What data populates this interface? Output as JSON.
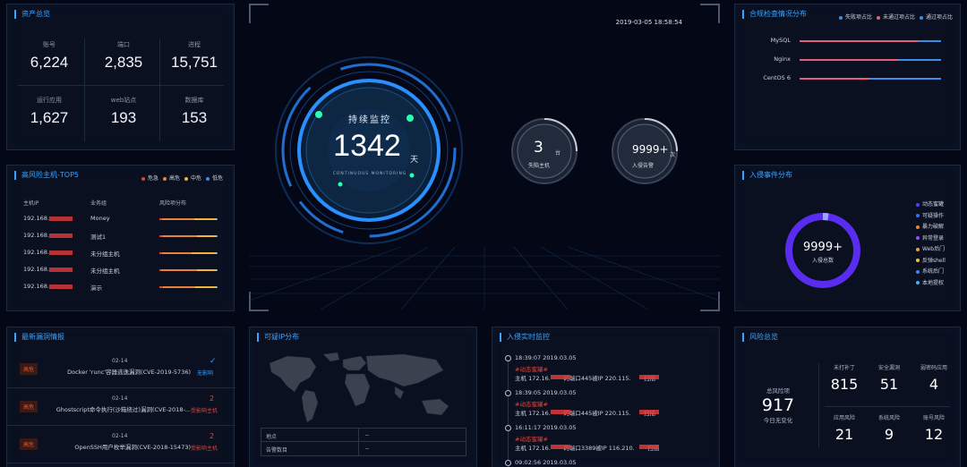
{
  "assets": {
    "title": "资产总览",
    "cells": [
      {
        "label": "账号",
        "value": "6,224"
      },
      {
        "label": "端口",
        "value": "2,835"
      },
      {
        "label": "进程",
        "value": "15,751"
      },
      {
        "label": "运行应用",
        "value": "1,627"
      },
      {
        "label": "web站点",
        "value": "193"
      },
      {
        "label": "数据库",
        "value": "153"
      }
    ]
  },
  "risk_hosts": {
    "title": "高风险主机-TOP5",
    "legend": [
      {
        "label": "危急",
        "color": "#e0453a"
      },
      {
        "label": "高危",
        "color": "#e8823a"
      },
      {
        "label": "中危",
        "color": "#f0b43a"
      },
      {
        "label": "低危",
        "color": "#3a8ee8"
      }
    ],
    "headers": {
      "ip": "主机IP",
      "group": "业务组",
      "dist": "风险项分布"
    },
    "rows": [
      {
        "ip": "192.168.",
        "group": "Money",
        "dist": [
          0.05,
          0.55,
          0.38,
          0.02
        ]
      },
      {
        "ip": "192.168.",
        "group": "测试1",
        "dist": [
          0.04,
          0.6,
          0.34,
          0.02
        ]
      },
      {
        "ip": "192.168.",
        "group": "未分组主机",
        "dist": [
          0.05,
          0.5,
          0.43,
          0.02
        ]
      },
      {
        "ip": "192.168.",
        "group": "未分组主机",
        "dist": [
          0.03,
          0.62,
          0.33,
          0.02
        ]
      },
      {
        "ip": "192.168.",
        "group": "演示",
        "dist": [
          0.06,
          0.56,
          0.36,
          0.02
        ]
      }
    ]
  },
  "center": {
    "datetime": "2019-03-05 18:58:54",
    "monitor_label": "持续监控",
    "days": "1342",
    "days_unit": "天",
    "monitor_sub": "CONTINUOUS MONITORING",
    "hosts_value": "3",
    "hosts_unit": "台",
    "hosts_label": "失陷主机",
    "alerts_value": "9999+",
    "alerts_unit": "次",
    "alerts_label": "入侵告警"
  },
  "compliance": {
    "title": "合规检查情况分布",
    "legend": [
      {
        "label": "失败项占比",
        "color": "#3a8ee8"
      },
      {
        "label": "未通过项占比",
        "color": "#e0607a"
      },
      {
        "label": "通过项占比",
        "color": "#3a8ee8"
      }
    ],
    "rows": [
      {
        "name": "MySQL",
        "fail": 0.84,
        "pass": 0.16
      },
      {
        "name": "Nginx",
        "fail": 0.7,
        "pass": 0.3
      },
      {
        "name": "CentOS 6",
        "fail": 0.5,
        "pass": 0.5
      }
    ]
  },
  "intrusion": {
    "title": "入侵事件分布",
    "total": "9999+",
    "total_label": "入侵总数",
    "legend": [
      {
        "label": "动态蜜罐",
        "color": "#5a3aff"
      },
      {
        "label": "可疑操作",
        "color": "#3a6cff"
      },
      {
        "label": "暴力破解",
        "color": "#e8823a"
      },
      {
        "label": "异常登录",
        "color": "#9a4aff"
      },
      {
        "label": "Web后门",
        "color": "#e8a23a"
      },
      {
        "label": "反弹shell",
        "color": "#f0c43a"
      },
      {
        "label": "系统后门",
        "color": "#3a8ee8"
      },
      {
        "label": "本地提权",
        "color": "#3ab0ff"
      }
    ]
  },
  "vulns": {
    "title": "最新漏洞情报",
    "items": [
      {
        "level": "高危",
        "date": "02-14",
        "name": "Docker 'runc'容器逃逸漏洞(CVE-2019-5736)",
        "status": "无影响",
        "count": "",
        "ok": true
      },
      {
        "level": "高危",
        "date": "02-14",
        "name": "Ghostscript命令执行(沙箱绕过)漏洞(CVE-2018-...",
        "status": "受影响主机",
        "count": "2",
        "ok": false
      },
      {
        "level": "高危",
        "date": "02-14",
        "name": "OpenSSH用户枚举漏洞(CVE-2018-15473)",
        "status": "受影响主机",
        "count": "2",
        "ok": false
      }
    ]
  },
  "ipmap": {
    "title": "可疑IP分布",
    "rows": [
      {
        "label": "地点",
        "value": "--"
      },
      {
        "label": "告警数目",
        "value": "--"
      }
    ]
  },
  "realtime": {
    "title": "入侵实时监控",
    "items": [
      {
        "time": "18:39:07 2019.03.05",
        "tag": "#动态蜜罐#",
        "text": "主机 172.16.       的端口445被IP 220.115.       扫描"
      },
      {
        "time": "18:39:05 2019.03.05",
        "tag": "#动态蜜罐#",
        "text": "主机 172.16.       的端口445被IP 220.115.       扫描"
      },
      {
        "time": "16:11:17 2019.03.05",
        "tag": "#动态蜜罐#",
        "text": "主机 172.16.       的端口3389被IP 116.210.       扫描"
      },
      {
        "time": "09:02:56 2019.03.05",
        "tag": "",
        "text": ""
      }
    ]
  },
  "risk": {
    "title": "风险总览",
    "total_label": "总风险项",
    "total": "917",
    "today_label": "今日无变化",
    "cells": [
      {
        "label": "未打补丁",
        "value": "815"
      },
      {
        "label": "安全漏洞",
        "value": "51"
      },
      {
        "label": "弱密码应用",
        "value": "4"
      },
      {
        "label": "应用风险",
        "value": "21"
      },
      {
        "label": "系统风险",
        "value": "9"
      },
      {
        "label": "账号风险",
        "value": "12"
      }
    ]
  }
}
